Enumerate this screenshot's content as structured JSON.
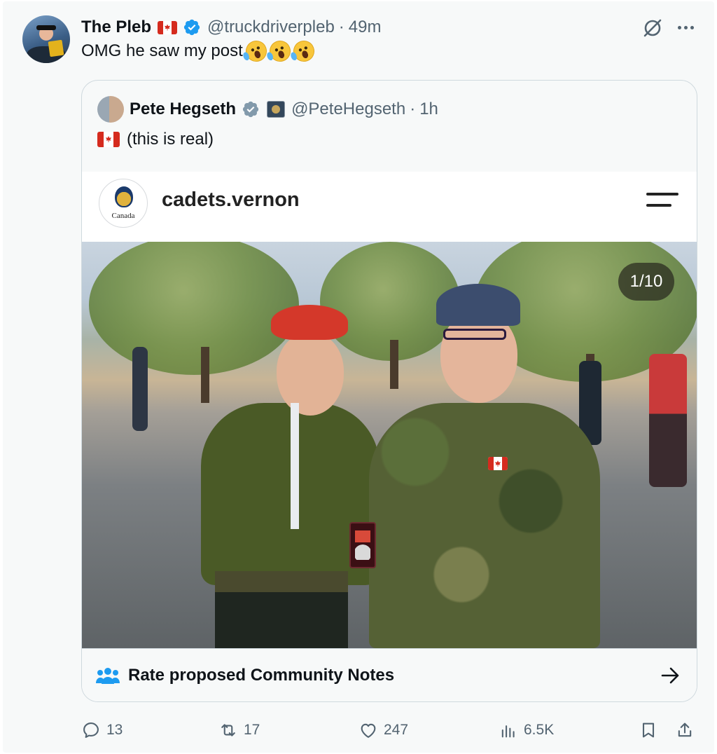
{
  "tweet": {
    "author_name": "The Pleb",
    "handle": "@truckdriverpleb",
    "separator": "·",
    "time": "49m",
    "text": "OMG he saw my post"
  },
  "quote": {
    "author_name": "Pete Hegseth",
    "handle": "@PeteHegseth",
    "separator": "·",
    "time": "1h",
    "text": "(this is real)",
    "media": {
      "account_name": "cadets.vernon",
      "logo_text": "Canada",
      "counter": "1/10"
    },
    "notes_label": "Rate proposed Community Notes"
  },
  "stats": {
    "replies": "13",
    "reposts": "17",
    "likes": "247",
    "views": "6.5K"
  },
  "icons": {
    "verified": "verified-badge-icon",
    "grok": "grok-icon",
    "more": "more-icon",
    "reply": "reply-icon",
    "repost": "repost-icon",
    "like": "like-icon",
    "views": "views-icon",
    "bookmark": "bookmark-icon",
    "share": "share-icon"
  },
  "colors": {
    "verified_blue": "#1d9bf0",
    "verified_gray": "#829aab",
    "text_secondary": "#536471",
    "beret_red": "#d4382a",
    "flag_red": "#d52b1e"
  }
}
